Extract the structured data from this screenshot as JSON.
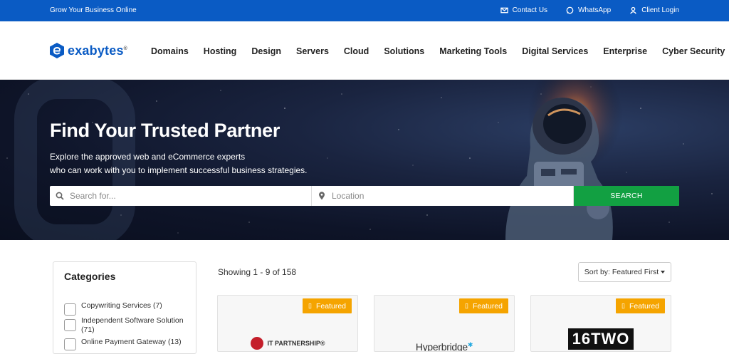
{
  "topbar": {
    "tagline": "Grow Your Business Online",
    "links": [
      {
        "label": "Contact Us",
        "icon": "mail-icon"
      },
      {
        "label": "WhatsApp",
        "icon": "whatsapp-icon"
      },
      {
        "label": "Client Login",
        "icon": "user-icon"
      }
    ]
  },
  "brand": {
    "name": "exabytes",
    "mark": "®",
    "color": "#0a5bc4"
  },
  "nav": {
    "items": [
      "Domains",
      "Hosting",
      "Design",
      "Servers",
      "Cloud",
      "Solutions",
      "Marketing Tools",
      "Digital Services",
      "Enterprise",
      "Cyber Security"
    ]
  },
  "hero": {
    "title": "Find Your Trusted Partner",
    "subtitle_line1": "Explore the approved web and eCommerce experts",
    "subtitle_line2": "who can work with you to implement successful business strategies.",
    "search_placeholder": "Search for...",
    "location_placeholder": "Location",
    "search_button": "SEARCH"
  },
  "sidebar": {
    "title": "Categories",
    "categories": [
      {
        "label": "Copywriting Services (7)"
      },
      {
        "label": "Independent Software Solution (71)"
      },
      {
        "label": "Online Payment Gateway (13)"
      }
    ]
  },
  "results": {
    "showing": "Showing 1 - 9 of 158",
    "sort_label": "Sort by: Featured First"
  },
  "cards": [
    {
      "badge": "Featured",
      "logo_text": "IT PARTNERSHIP®"
    },
    {
      "badge": "Featured",
      "logo_text": "Hyperbridge"
    },
    {
      "badge": "Featured",
      "logo_text": "16TWO"
    }
  ],
  "colors": {
    "topbar": "#0a5bc4",
    "search_button": "#12a042",
    "badge": "#f5a400"
  }
}
